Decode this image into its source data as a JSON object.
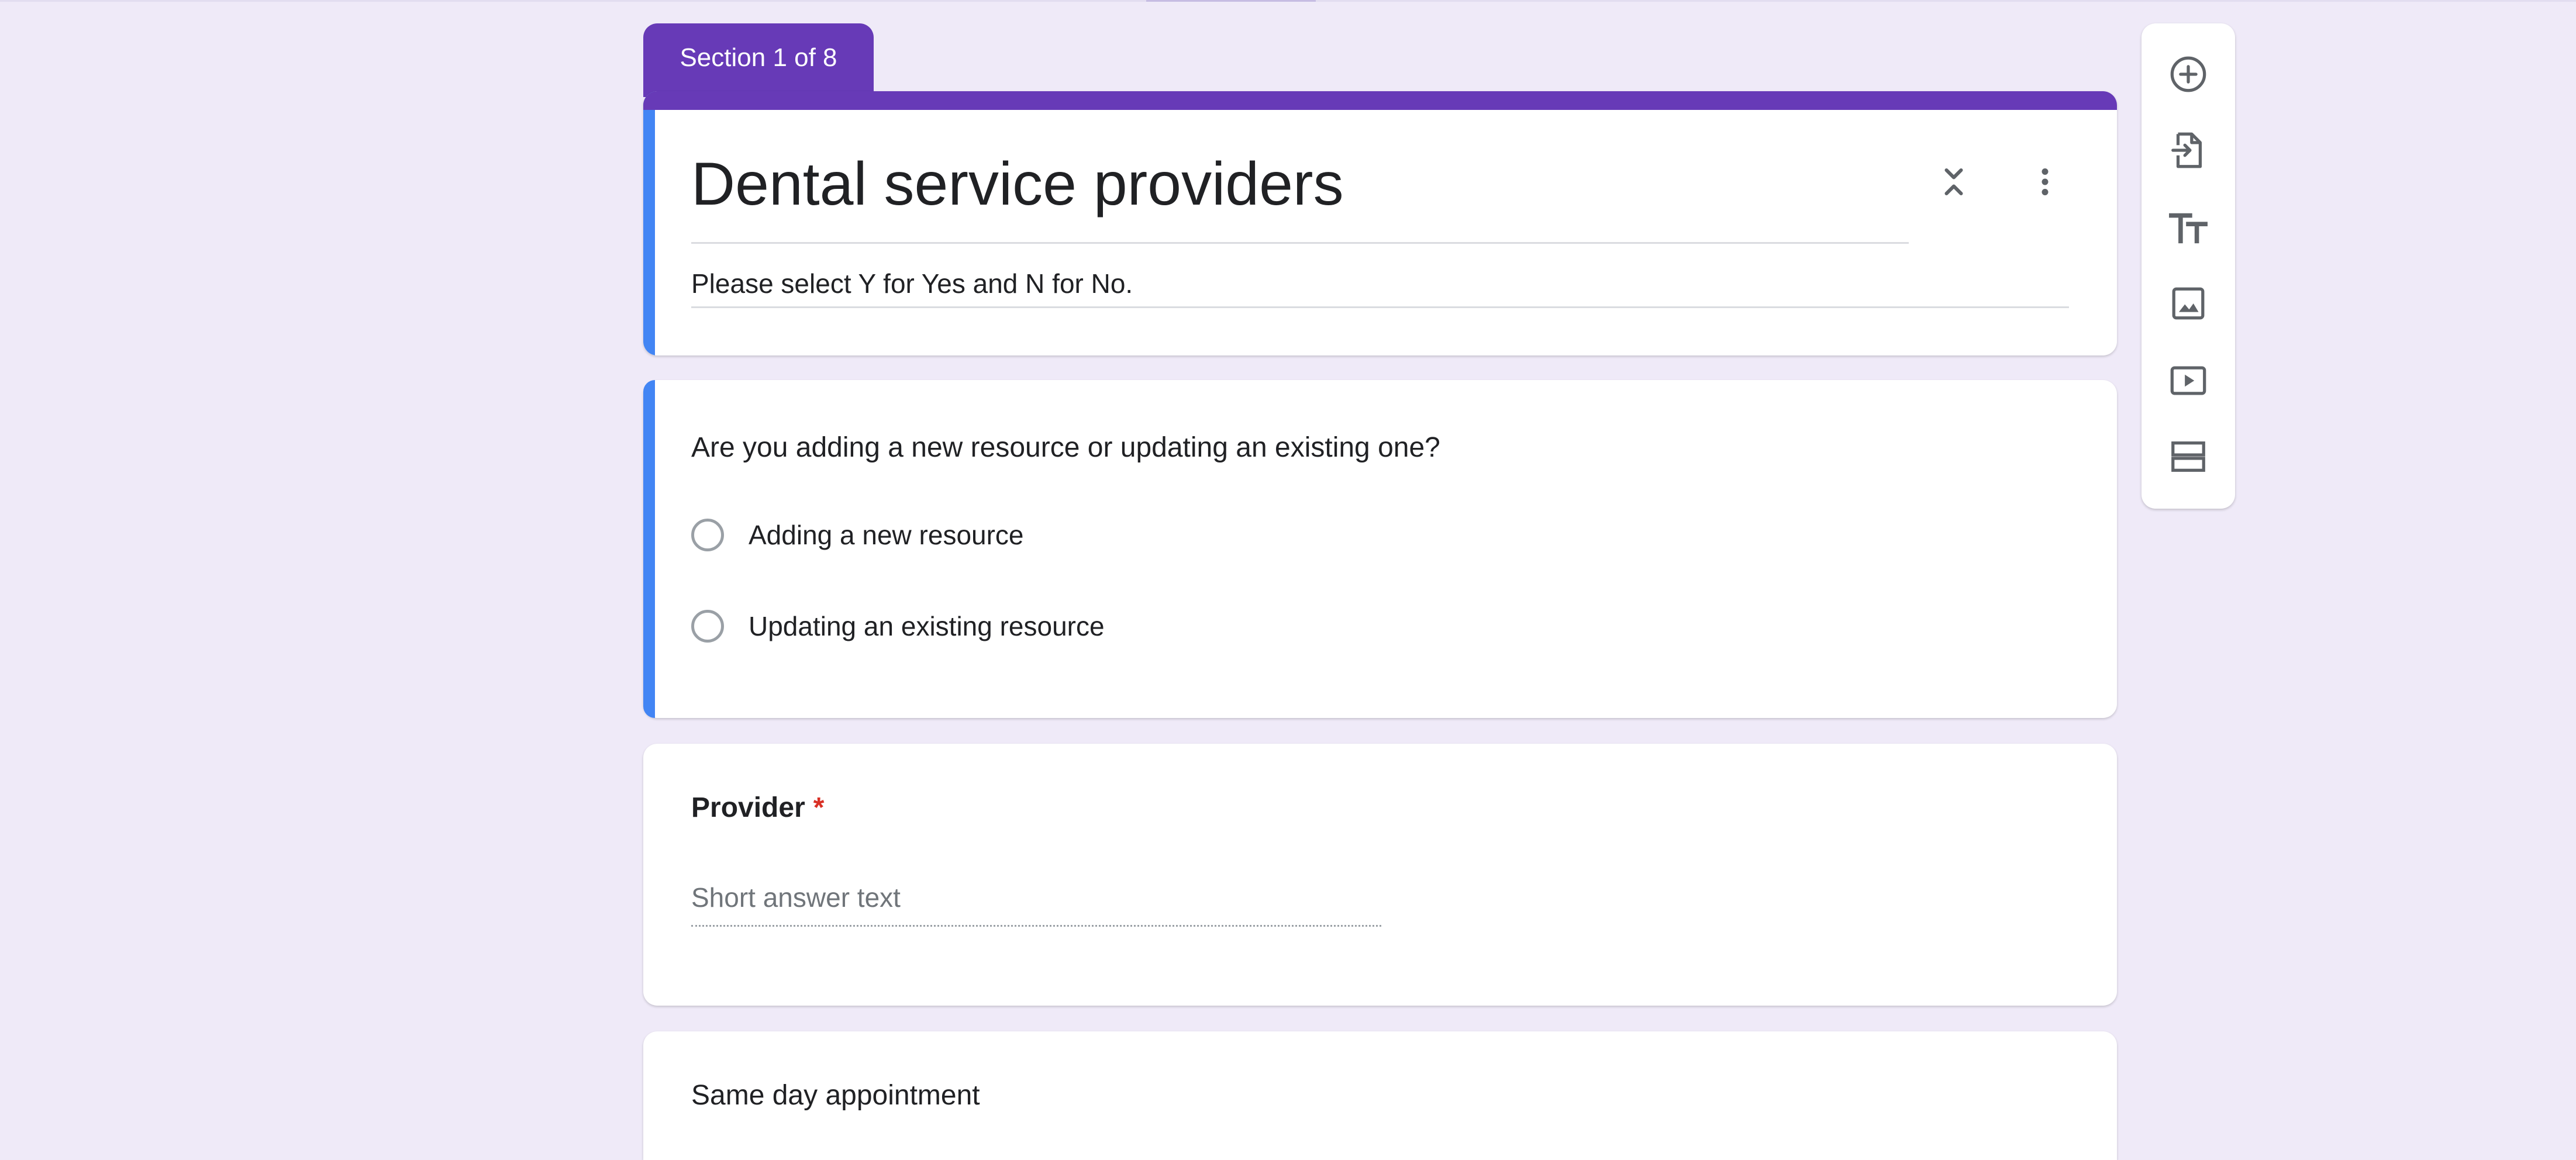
{
  "section_tab": {
    "label": "Section 1 of 8"
  },
  "header": {
    "title": "Dental service providers",
    "description": "Please select Y for Yes and N for No."
  },
  "questions": [
    {
      "text": "Are you adding a new resource or updating an existing one?",
      "type": "multiple-choice",
      "options": [
        "Adding a new resource",
        "Updating an existing resource"
      ]
    },
    {
      "text": "Provider",
      "required_mark": "*",
      "type": "short-answer",
      "placeholder": "Short answer text"
    },
    {
      "text": "Same day appointment",
      "type": "unknown"
    }
  ],
  "toolbar": {
    "tools": [
      {
        "icon": "add-question-icon"
      },
      {
        "icon": "import-questions-icon"
      },
      {
        "icon": "add-title-icon"
      },
      {
        "icon": "add-image-icon"
      },
      {
        "icon": "add-video-icon"
      },
      {
        "icon": "add-section-icon"
      }
    ]
  },
  "colors": {
    "theme": "#673ab7",
    "active_accent": "#4285f4",
    "background": "#efeaf8",
    "required": "#d93025"
  }
}
